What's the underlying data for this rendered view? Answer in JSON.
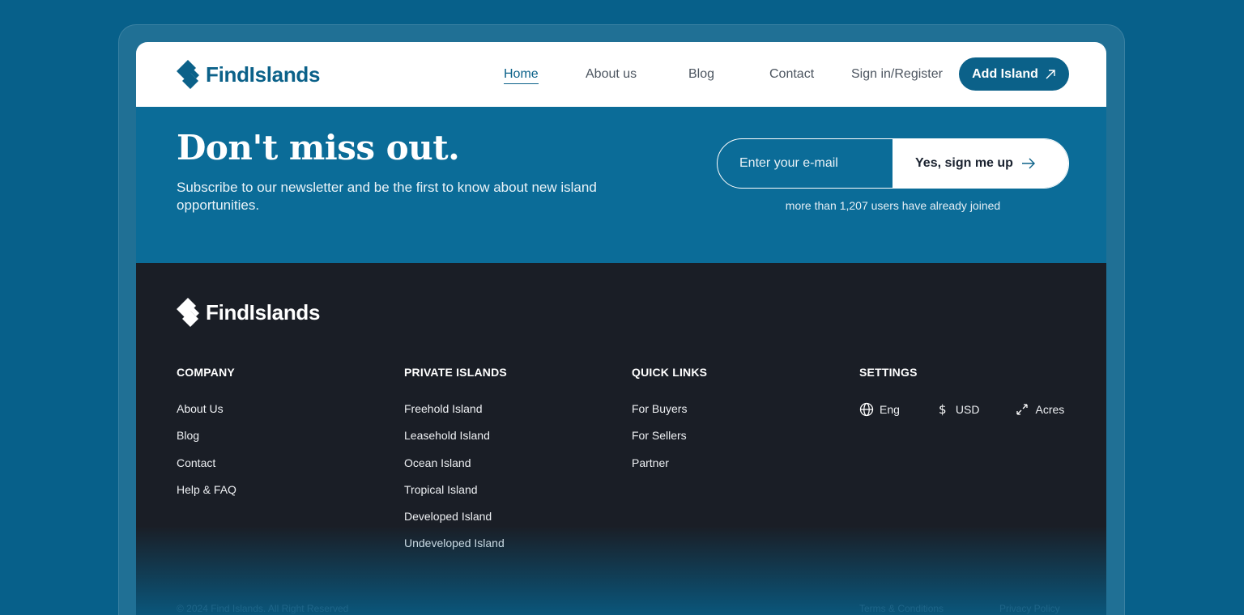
{
  "brand": {
    "name": "FindIslands",
    "accent": "#0b6189"
  },
  "nav": {
    "items": [
      "Home",
      "About us",
      "Blog",
      "Contact"
    ],
    "active": "Home",
    "signin_label": "Sign in/Register",
    "add_button_label": "Add Island"
  },
  "newsletter": {
    "title": "Don't miss out.",
    "subtitle": "Subscribe to our newsletter and be the first to know about new island opportunities.",
    "email_placeholder": "Enter your e-mail",
    "button_label": "Yes, sign me up",
    "note": "more than 1,207 users have already joined"
  },
  "footer": {
    "columns": [
      {
        "heading": "COMPANY",
        "items": [
          "About Us",
          "Blog",
          "Contact",
          "Help & FAQ"
        ]
      },
      {
        "heading": "PRIVATE ISLANDS",
        "items": [
          "Freehold Island",
          "Leasehold Island",
          "Ocean Island",
          "Tropical Island",
          "Developed Island",
          "Undeveloped Island"
        ]
      },
      {
        "heading": "QUICK LINKS",
        "items": [
          "For Buyers",
          "For Sellers",
          "Partner"
        ]
      }
    ],
    "settings": {
      "heading": "SETTINGS",
      "language": "Eng",
      "currency": "USD",
      "unit": "Acres"
    },
    "copyright": "© 2024 Find Islands. All Right Reserved",
    "terms_label": "Terms & Conditions",
    "privacy_label": "Privacy Policy"
  }
}
